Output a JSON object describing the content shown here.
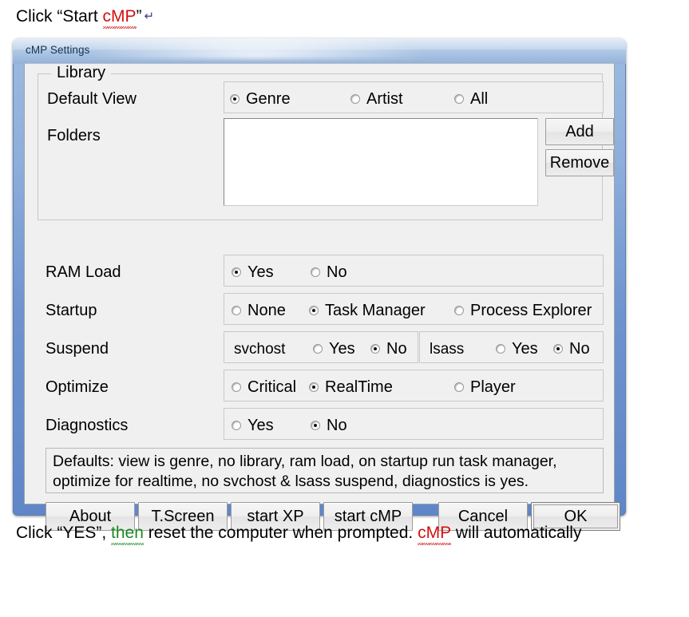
{
  "document": {
    "top_caption_prefix": "Click “Start ",
    "top_caption_squiggle": "cMP",
    "top_caption_suffix": "”",
    "pilcrow": "↵",
    "bottom_caption_a": "Click “YES”, ",
    "bottom_caption_then": "then",
    "bottom_caption_b": " reset the computer when prompted. ",
    "bottom_caption_cmp": "cMP",
    "bottom_caption_c": " will automatically"
  },
  "window": {
    "title": "cMP Settings"
  },
  "library": {
    "group_title": "Library",
    "default_view_label": "Default View",
    "default_view_options": [
      {
        "label": "Genre",
        "checked": true
      },
      {
        "label": "Artist",
        "checked": false
      },
      {
        "label": "All",
        "checked": false
      }
    ],
    "folders_label": "Folders",
    "folders_items": [],
    "add_button": "Add",
    "remove_button": "Remove"
  },
  "settings": {
    "ram_load": {
      "label": "RAM Load",
      "options": [
        {
          "label": "Yes",
          "checked": true
        },
        {
          "label": "No",
          "checked": false
        }
      ]
    },
    "startup": {
      "label": "Startup",
      "options": [
        {
          "label": "None",
          "checked": false
        },
        {
          "label": "Task Manager",
          "checked": true
        },
        {
          "label": "Process Explorer",
          "checked": false
        }
      ]
    },
    "suspend": {
      "label": "Suspend",
      "groups": [
        {
          "name": "svchost",
          "options": [
            {
              "label": "Yes",
              "checked": false
            },
            {
              "label": "No",
              "checked": true
            }
          ]
        },
        {
          "name": "lsass",
          "options": [
            {
              "label": "Yes",
              "checked": false
            },
            {
              "label": "No",
              "checked": true
            }
          ]
        }
      ]
    },
    "optimize": {
      "label": "Optimize",
      "options": [
        {
          "label": "Critical",
          "checked": false
        },
        {
          "label": "RealTime",
          "checked": true
        },
        {
          "label": "Player",
          "checked": false
        }
      ]
    },
    "diagnostics": {
      "label": "Diagnostics",
      "options": [
        {
          "label": "Yes",
          "checked": false
        },
        {
          "label": "No",
          "checked": true
        }
      ]
    }
  },
  "note": {
    "line1": "Defaults: view is genre, no library, ram load, on startup run task manager,",
    "line2": "optimize for realtime, no svchost & lsass suspend, diagnostics is yes."
  },
  "buttons": {
    "about": "About",
    "tscreen": "T.Screen",
    "start_xp": "start XP",
    "start_cmp": "start cMP",
    "cancel": "Cancel",
    "ok": "OK"
  },
  "colors": {
    "window_frame": "#7fa2d6",
    "client_bg": "#f0f0f0",
    "title_text": "#16324f",
    "spell_red": "#d31010",
    "grammar_green": "#1b8a23"
  }
}
